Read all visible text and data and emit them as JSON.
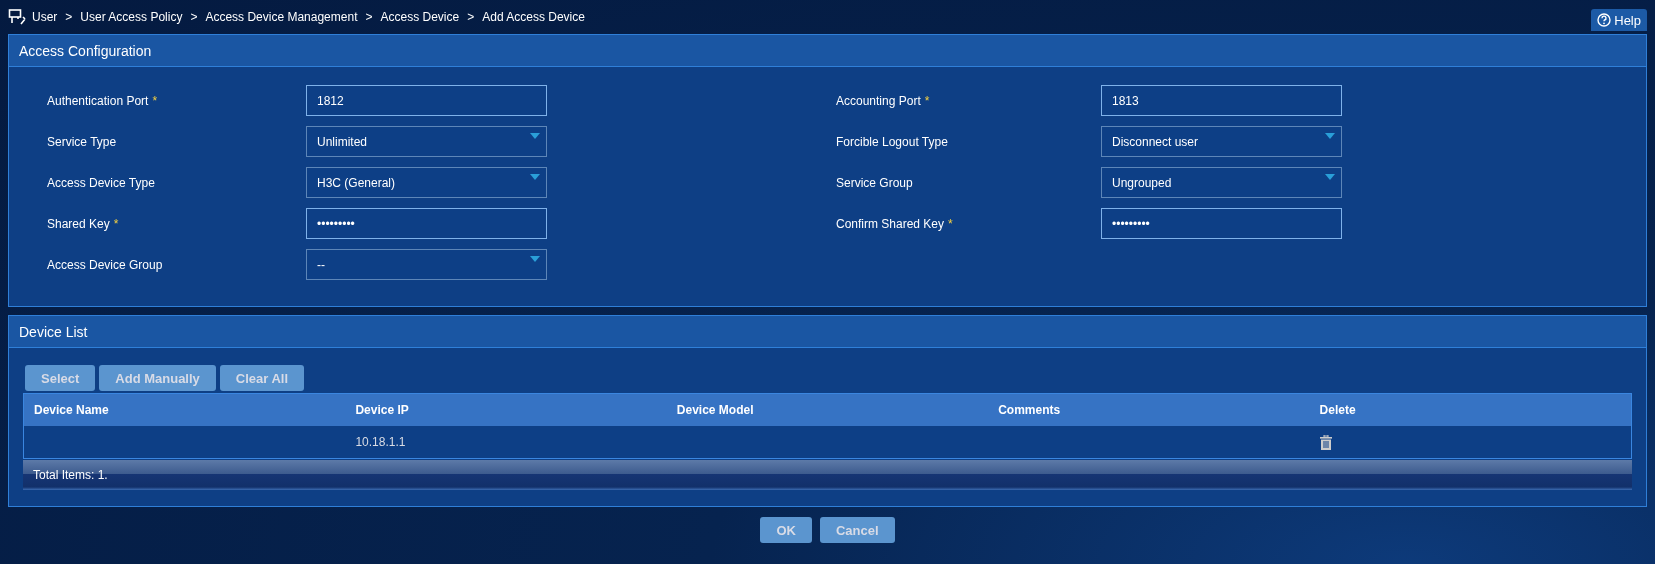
{
  "breadcrumb": [
    "User",
    "User Access Policy",
    "Access Device Management",
    "Access Device",
    "Add Access Device"
  ],
  "breadcrumb_separator": ">",
  "help_button": "Help",
  "access_configuration": {
    "title": "Access Configuration",
    "required_mark": "*",
    "fields": [
      {
        "label": "Authentication Port",
        "required": true,
        "kind": "text",
        "value": "1812"
      },
      {
        "label": "Accounting Port",
        "required": true,
        "kind": "text",
        "value": "1813"
      },
      {
        "label": "Service Type",
        "required": false,
        "kind": "select",
        "value": "Unlimited"
      },
      {
        "label": "Forcible Logout Type",
        "required": false,
        "kind": "select",
        "value": "Disconnect user"
      },
      {
        "label": "Access Device Type",
        "required": false,
        "kind": "select",
        "value": "H3C (General)"
      },
      {
        "label": "Service Group",
        "required": false,
        "kind": "select",
        "value": "Ungrouped"
      },
      {
        "label": "Shared Key",
        "required": true,
        "kind": "password",
        "value": "•••••••••"
      },
      {
        "label": "Confirm Shared Key",
        "required": true,
        "kind": "password",
        "value": "•••••••••"
      },
      {
        "label": "Access Device Group",
        "required": false,
        "kind": "select",
        "value": "--"
      }
    ]
  },
  "device_list": {
    "title": "Device List",
    "buttons": [
      "Select",
      "Add Manually",
      "Clear All"
    ],
    "table": {
      "columns": [
        "Device Name",
        "Device IP",
        "Device Model",
        "Comments",
        "Delete"
      ],
      "rows": [
        {
          "device_name": "",
          "device_ip": "10.18.1.1",
          "device_model": "",
          "comments": ""
        }
      ]
    },
    "total": "Total Items: 1."
  },
  "footer_buttons": [
    "OK",
    "Cancel"
  ]
}
